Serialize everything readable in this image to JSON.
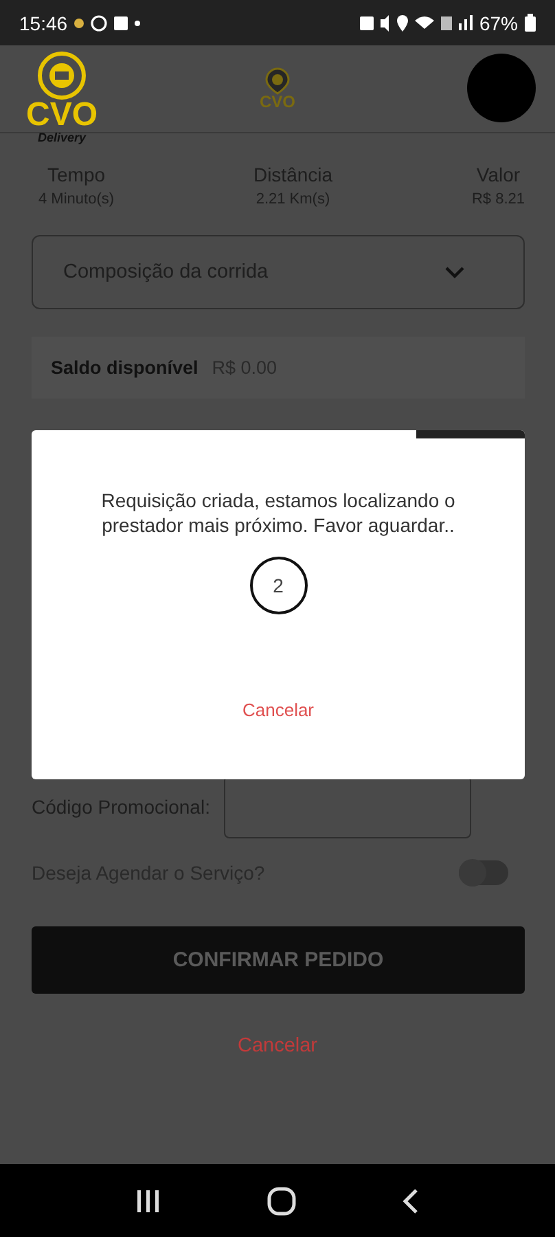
{
  "status_bar": {
    "time": "15:46",
    "battery": "67%"
  },
  "header": {
    "logo_text": "CVO",
    "logo_subtext": "Delivery",
    "center_logo_text": "CVO"
  },
  "stats": [
    {
      "label": "Tempo",
      "value": "4 Minuto(s)"
    },
    {
      "label": "Distância",
      "value": "2.21 Km(s)"
    },
    {
      "label": "Valor",
      "value": "R$ 8.21"
    }
  ],
  "dropdown": {
    "label": "Composição da corrida",
    "expanded": false
  },
  "balance": {
    "label": "Saldo disponível",
    "value": "R$ 0.00"
  },
  "promo": {
    "label": "Código Promocional:"
  },
  "schedule": {
    "label": "Deseja Agendar o Serviço?",
    "on": false
  },
  "confirm_button": "CONFIRMAR PEDIDO",
  "cancel_link": "Cancelar",
  "dialog": {
    "progress": {
      "level": 0.22
    },
    "message": "Requisição criada, estamos localizando o prestador mais próximo. Favor aguardar..",
    "countdown": "2",
    "cancel": "Cancelar"
  }
}
